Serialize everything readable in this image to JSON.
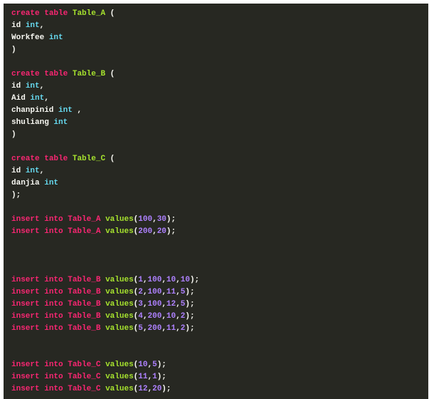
{
  "theme": {
    "background": "#272822",
    "keyword": "#f92672",
    "name": "#a6e22e",
    "type": "#66d9ef",
    "number": "#ae81ff",
    "plain": "#f8f8f2"
  },
  "lines": [
    [
      [
        "kw",
        "create"
      ],
      [
        "plain",
        " "
      ],
      [
        "kw",
        "table"
      ],
      [
        "plain",
        " "
      ],
      [
        "name",
        "Table_A"
      ],
      [
        "plain",
        " ("
      ]
    ],
    [
      [
        "plain",
        "id "
      ],
      [
        "type",
        "int"
      ],
      [
        "plain",
        ","
      ]
    ],
    [
      [
        "plain",
        "Workfee "
      ],
      [
        "type",
        "int"
      ]
    ],
    [
      [
        "plain",
        ")"
      ]
    ],
    [],
    [
      [
        "kw",
        "create"
      ],
      [
        "plain",
        " "
      ],
      [
        "kw",
        "table"
      ],
      [
        "plain",
        " "
      ],
      [
        "name",
        "Table_B"
      ],
      [
        "plain",
        " ("
      ]
    ],
    [
      [
        "plain",
        "id "
      ],
      [
        "type",
        "int"
      ],
      [
        "plain",
        ","
      ]
    ],
    [
      [
        "plain",
        "Aid "
      ],
      [
        "type",
        "int"
      ],
      [
        "plain",
        ","
      ]
    ],
    [
      [
        "plain",
        "chanpinid "
      ],
      [
        "type",
        "int"
      ],
      [
        "plain",
        " ,"
      ]
    ],
    [
      [
        "plain",
        "shuliang "
      ],
      [
        "type",
        "int"
      ]
    ],
    [
      [
        "plain",
        ")"
      ]
    ],
    [],
    [
      [
        "kw",
        "create"
      ],
      [
        "plain",
        " "
      ],
      [
        "kw",
        "table"
      ],
      [
        "plain",
        " "
      ],
      [
        "name",
        "Table_C"
      ],
      [
        "plain",
        " ("
      ]
    ],
    [
      [
        "plain",
        "id "
      ],
      [
        "type",
        "int"
      ],
      [
        "plain",
        ","
      ]
    ],
    [
      [
        "plain",
        "danjia "
      ],
      [
        "type",
        "int"
      ]
    ],
    [
      [
        "plain",
        ");"
      ]
    ],
    [],
    [
      [
        "kw",
        "insert"
      ],
      [
        "plain",
        " "
      ],
      [
        "kw",
        "into"
      ],
      [
        "plain",
        " "
      ],
      [
        "kw",
        "Table_A"
      ],
      [
        "plain",
        " "
      ],
      [
        "name",
        "values"
      ],
      [
        "plain",
        "("
      ],
      [
        "num",
        "100"
      ],
      [
        "plain",
        ","
      ],
      [
        "num",
        "30"
      ],
      [
        "plain",
        ");"
      ]
    ],
    [
      [
        "kw",
        "insert"
      ],
      [
        "plain",
        " "
      ],
      [
        "kw",
        "into"
      ],
      [
        "plain",
        " "
      ],
      [
        "kw",
        "Table_A"
      ],
      [
        "plain",
        " "
      ],
      [
        "name",
        "values"
      ],
      [
        "plain",
        "("
      ],
      [
        "num",
        "200"
      ],
      [
        "plain",
        ","
      ],
      [
        "num",
        "20"
      ],
      [
        "plain",
        ");"
      ]
    ],
    [],
    [],
    [],
    [
      [
        "kw",
        "insert"
      ],
      [
        "plain",
        " "
      ],
      [
        "kw",
        "into"
      ],
      [
        "plain",
        " "
      ],
      [
        "kw",
        "Table_B"
      ],
      [
        "plain",
        " "
      ],
      [
        "name",
        "values"
      ],
      [
        "plain",
        "("
      ],
      [
        "num",
        "1"
      ],
      [
        "plain",
        ","
      ],
      [
        "num",
        "100"
      ],
      [
        "plain",
        ","
      ],
      [
        "num",
        "10"
      ],
      [
        "plain",
        ","
      ],
      [
        "num",
        "10"
      ],
      [
        "plain",
        ");"
      ]
    ],
    [
      [
        "kw",
        "insert"
      ],
      [
        "plain",
        " "
      ],
      [
        "kw",
        "into"
      ],
      [
        "plain",
        " "
      ],
      [
        "kw",
        "Table_B"
      ],
      [
        "plain",
        " "
      ],
      [
        "name",
        "values"
      ],
      [
        "plain",
        "("
      ],
      [
        "num",
        "2"
      ],
      [
        "plain",
        ","
      ],
      [
        "num",
        "100"
      ],
      [
        "plain",
        ","
      ],
      [
        "num",
        "11"
      ],
      [
        "plain",
        ","
      ],
      [
        "num",
        "5"
      ],
      [
        "plain",
        ");"
      ]
    ],
    [
      [
        "kw",
        "insert"
      ],
      [
        "plain",
        " "
      ],
      [
        "kw",
        "into"
      ],
      [
        "plain",
        " "
      ],
      [
        "kw",
        "Table_B"
      ],
      [
        "plain",
        " "
      ],
      [
        "name",
        "values"
      ],
      [
        "plain",
        "("
      ],
      [
        "num",
        "3"
      ],
      [
        "plain",
        ","
      ],
      [
        "num",
        "100"
      ],
      [
        "plain",
        ","
      ],
      [
        "num",
        "12"
      ],
      [
        "plain",
        ","
      ],
      [
        "num",
        "5"
      ],
      [
        "plain",
        ");"
      ]
    ],
    [
      [
        "kw",
        "insert"
      ],
      [
        "plain",
        " "
      ],
      [
        "kw",
        "into"
      ],
      [
        "plain",
        " "
      ],
      [
        "kw",
        "Table_B"
      ],
      [
        "plain",
        " "
      ],
      [
        "name",
        "values"
      ],
      [
        "plain",
        "("
      ],
      [
        "num",
        "4"
      ],
      [
        "plain",
        ","
      ],
      [
        "num",
        "200"
      ],
      [
        "plain",
        ","
      ],
      [
        "num",
        "10"
      ],
      [
        "plain",
        ","
      ],
      [
        "num",
        "2"
      ],
      [
        "plain",
        ");"
      ]
    ],
    [
      [
        "kw",
        "insert"
      ],
      [
        "plain",
        " "
      ],
      [
        "kw",
        "into"
      ],
      [
        "plain",
        " "
      ],
      [
        "kw",
        "Table_B"
      ],
      [
        "plain",
        " "
      ],
      [
        "name",
        "values"
      ],
      [
        "plain",
        "("
      ],
      [
        "num",
        "5"
      ],
      [
        "plain",
        ","
      ],
      [
        "num",
        "200"
      ],
      [
        "plain",
        ","
      ],
      [
        "num",
        "11"
      ],
      [
        "plain",
        ","
      ],
      [
        "num",
        "2"
      ],
      [
        "plain",
        ");"
      ]
    ],
    [],
    [],
    [
      [
        "kw",
        "insert"
      ],
      [
        "plain",
        " "
      ],
      [
        "kw",
        "into"
      ],
      [
        "plain",
        " "
      ],
      [
        "kw",
        "Table_C"
      ],
      [
        "plain",
        " "
      ],
      [
        "name",
        "values"
      ],
      [
        "plain",
        "("
      ],
      [
        "num",
        "10"
      ],
      [
        "plain",
        ","
      ],
      [
        "num",
        "5"
      ],
      [
        "plain",
        ");"
      ]
    ],
    [
      [
        "kw",
        "insert"
      ],
      [
        "plain",
        " "
      ],
      [
        "kw",
        "into"
      ],
      [
        "plain",
        " "
      ],
      [
        "kw",
        "Table_C"
      ],
      [
        "plain",
        " "
      ],
      [
        "name",
        "values"
      ],
      [
        "plain",
        "("
      ],
      [
        "num",
        "11"
      ],
      [
        "plain",
        ","
      ],
      [
        "num",
        "1"
      ],
      [
        "plain",
        ");"
      ]
    ],
    [
      [
        "kw",
        "insert"
      ],
      [
        "plain",
        " "
      ],
      [
        "kw",
        "into"
      ],
      [
        "plain",
        " "
      ],
      [
        "kw",
        "Table_C"
      ],
      [
        "plain",
        " "
      ],
      [
        "name",
        "values"
      ],
      [
        "plain",
        "("
      ],
      [
        "num",
        "12"
      ],
      [
        "plain",
        ","
      ],
      [
        "num",
        "20"
      ],
      [
        "plain",
        ");"
      ]
    ]
  ]
}
